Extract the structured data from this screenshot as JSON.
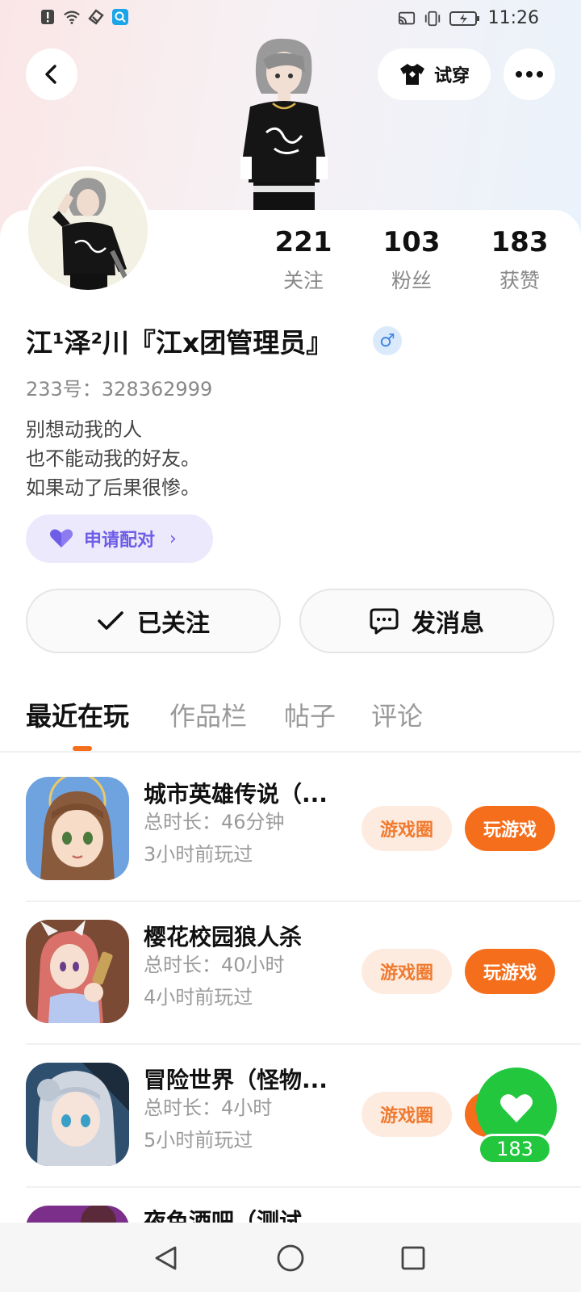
{
  "status_bar": {
    "time": "11:26",
    "icons_left": [
      "alert-icon",
      "wifi-icon",
      "sync-icon",
      "search-app-icon"
    ],
    "icons_right": [
      "cast-icon",
      "vibrate-icon",
      "battery-icon"
    ]
  },
  "header": {
    "tryon_label": "试穿"
  },
  "profile": {
    "nickname": "江¹泽²川『江x团管理员』",
    "gender_symbol": "♂",
    "id_line": "233号：328362999",
    "bio_lines": [
      "别想动我的人",
      "也不能动我的好友。",
      "如果动了后果很惨。"
    ],
    "pair_label": "申请配对"
  },
  "stats": {
    "following": {
      "value": "221",
      "label": "关注"
    },
    "fans": {
      "value": "103",
      "label": "粉丝"
    },
    "likes": {
      "value": "183",
      "label": "获赞"
    }
  },
  "actions": {
    "followed_label": "已关注",
    "message_label": "发消息"
  },
  "tabs": [
    {
      "label": "最近在玩",
      "active": true
    },
    {
      "label": "作品栏",
      "active": false
    },
    {
      "label": "帖子",
      "active": false
    },
    {
      "label": "评论",
      "active": false
    }
  ],
  "games": [
    {
      "title": "城市英雄传说（...",
      "duration": "总时长：46分钟",
      "last_played": "3小时前玩过",
      "circle_label": "游戏圈",
      "play_label": "玩游戏"
    },
    {
      "title": "樱花校园狼人杀",
      "duration": "总时长：40小时",
      "last_played": "4小时前玩过",
      "circle_label": "游戏圈",
      "play_label": "玩游戏"
    },
    {
      "title": "冒险世界（怪物...",
      "duration": "总时长：4小时",
      "last_played": "5小时前玩过",
      "circle_label": "游戏圈",
      "play_label": "玩游戏"
    },
    {
      "title": "夜色酒吧（测试",
      "duration": "",
      "last_played": "",
      "circle_label": "",
      "play_label": ""
    }
  ],
  "like_fab": {
    "count": "183"
  },
  "colors": {
    "accent_orange": "#f56e1b",
    "pair_purple": "#6e5de6",
    "like_green": "#22c73d"
  }
}
